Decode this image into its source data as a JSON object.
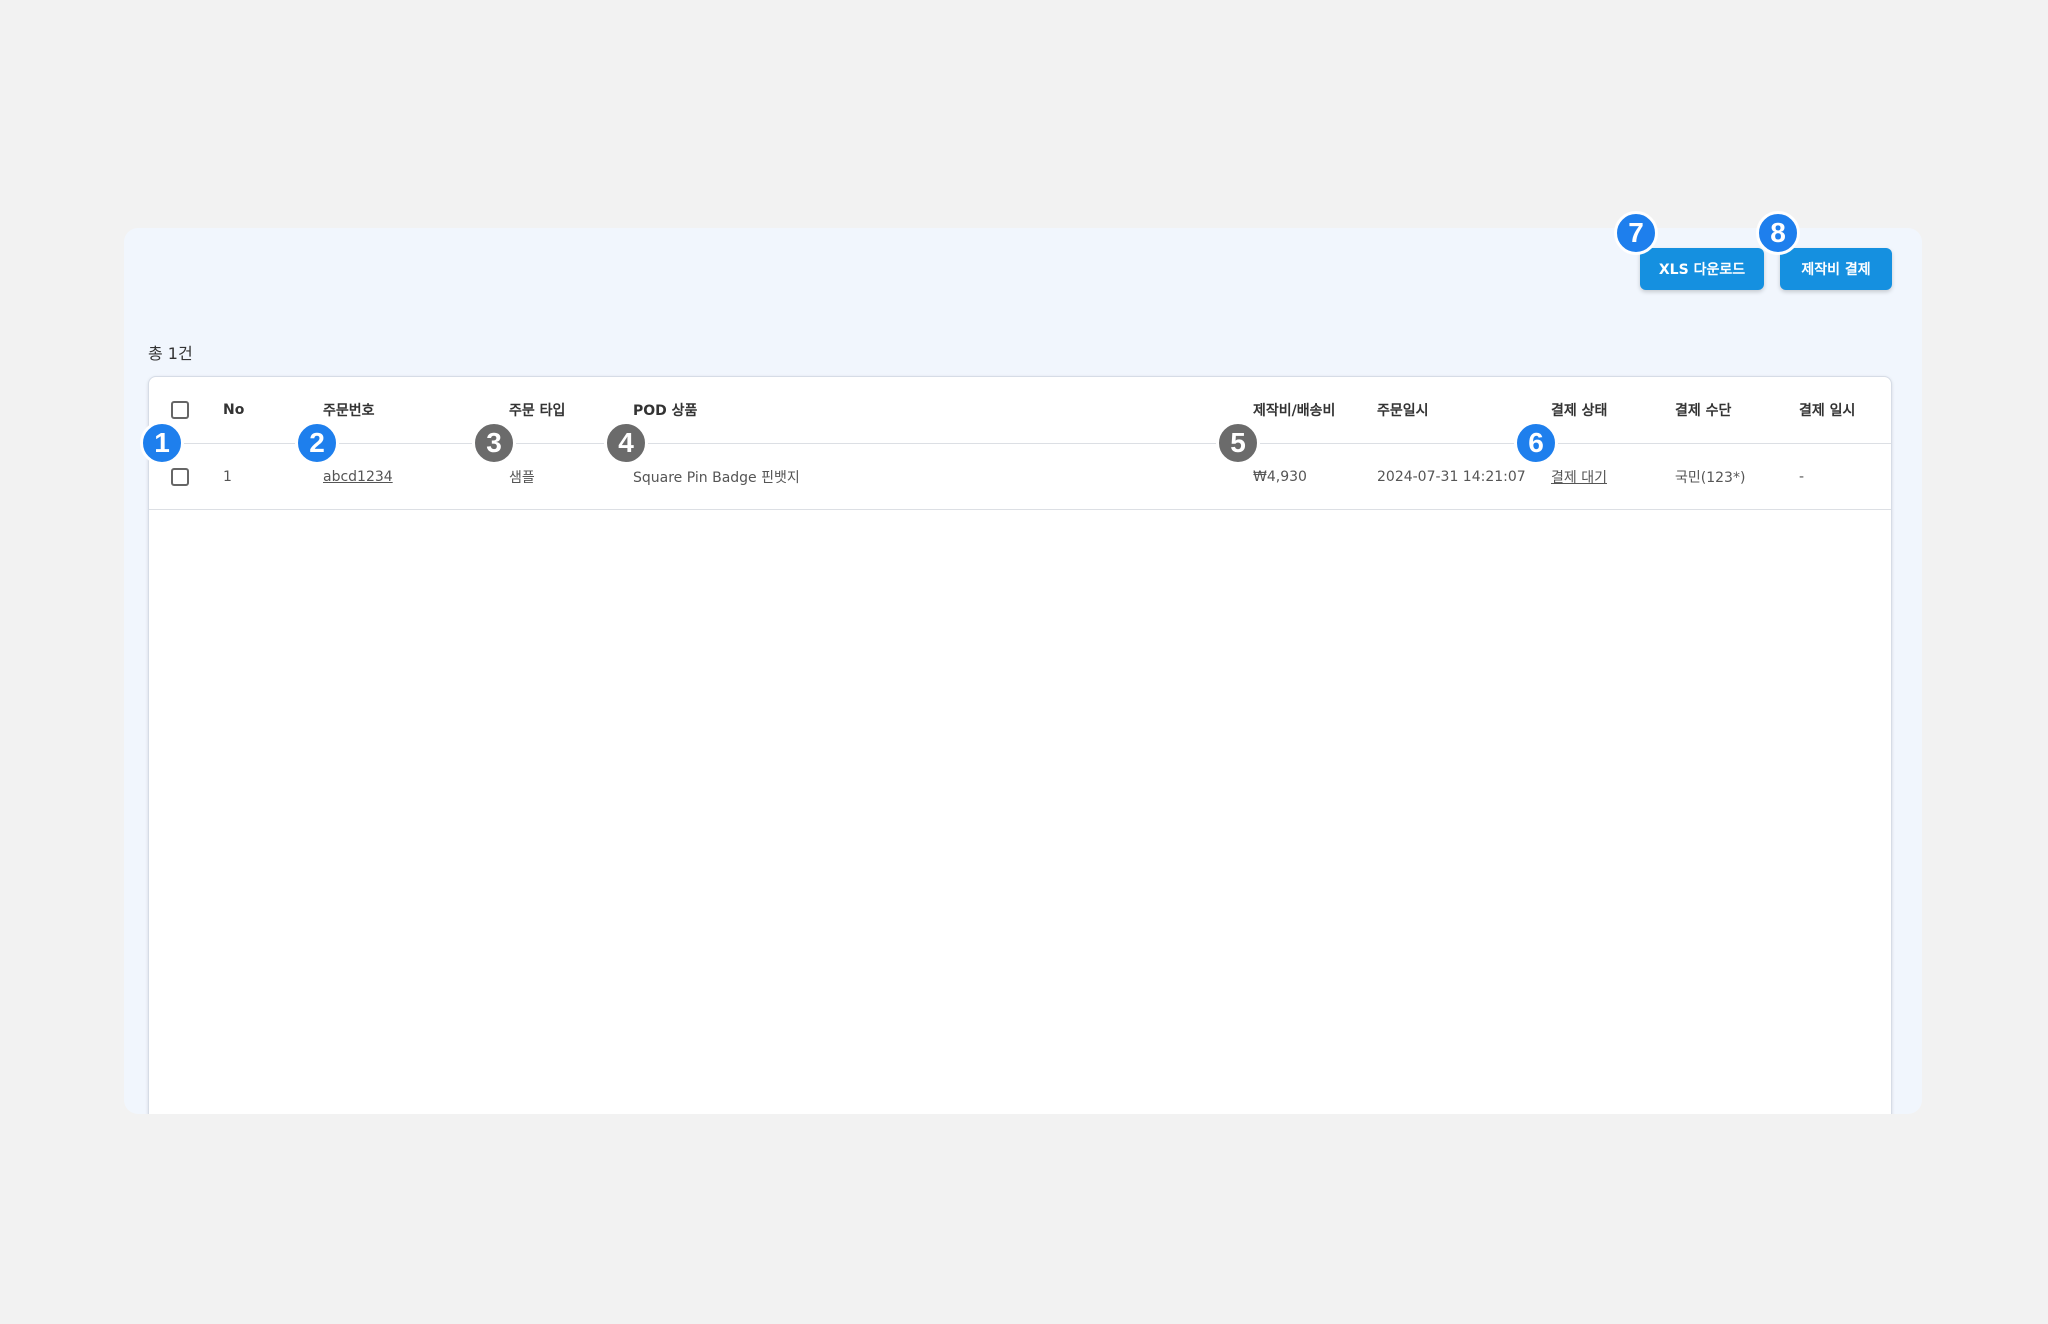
{
  "toolbar": {
    "xls_label": "XLS 다운로드",
    "pay_label": "제작비 결제"
  },
  "summary": {
    "total_label": "총 1건"
  },
  "table": {
    "headers": {
      "no": "No",
      "order_no": "주문번호",
      "order_type": "주문 타입",
      "pod_product": "POD 상품",
      "cost": "제작비/배송비",
      "order_date": "주문일시",
      "pay_status": "결제 상태",
      "pay_method": "결제 수단",
      "pay_date": "결제 일시"
    },
    "rows": [
      {
        "no": "1",
        "order_no": "abcd1234",
        "order_type": "샘플",
        "pod_product": "Square Pin Badge 핀뱃지",
        "cost": "₩4,930",
        "order_date": "2024-07-31 14:21:07",
        "pay_status": "결제 대기",
        "pay_method": "국민(123*)",
        "pay_date": "-"
      }
    ]
  },
  "callouts": [
    "1",
    "2",
    "3",
    "4",
    "5",
    "6",
    "7",
    "8"
  ],
  "colors": {
    "button": "#1590e0",
    "callout_blue": "#1e7fed",
    "callout_gray": "#6b6b6b",
    "panel_bg": "#f1f6fd"
  }
}
